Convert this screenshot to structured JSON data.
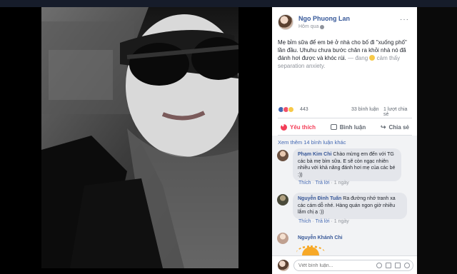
{
  "post": {
    "author": "Ngo Phuong Lan",
    "time": "Hôm qua",
    "more_label": "···",
    "text": "Mẹ bỉm sữa để em bé ở nhà cho bố đi \"xuống phố\" lần đầu. Uhuhu chưa bước chân ra khỏi nhà nó đã đánh hơi được và khóc rùi.",
    "mood_prefix": " — đang",
    "mood_text": " cảm thấy separation anxiety."
  },
  "stats": {
    "reactions": "443",
    "comments": "33 bình luận",
    "shares": "1 lượt chia sẻ"
  },
  "actions": {
    "like": "Yêu thích",
    "comment": "Bình luận",
    "share": "Chia sẻ"
  },
  "comments": {
    "view_more": "Xem thêm 14 bình luận khác",
    "items": [
      {
        "name": "Phạm Kim Chi",
        "text": " Chào mừng em đến với TG các bà mẹ bỉm sữa. E sẽ còn ngạc nhiên nhiều với khả năng đánh hơi mẹ của các bé :))",
        "like": "Thích",
        "reply": "Trả lời",
        "ago": "1 ngày"
      },
      {
        "name": "Nguyễn Đình Tuấn",
        "text": " Ra đường nhớ tranh xa các cám dỗ nhé. Hàng quán ngon giờ nhiều lắm chị ạ :))",
        "like": "Thích",
        "reply": "Trả lời",
        "ago": "1 ngày"
      },
      {
        "name": "Nguyễn Khánh Chi",
        "text": "",
        "sticker": "sun-sticker"
      }
    ]
  },
  "reply": {
    "placeholder": "Viết bình luận..."
  },
  "colors": {
    "link": "#4267b2",
    "love": "#f33e58"
  }
}
